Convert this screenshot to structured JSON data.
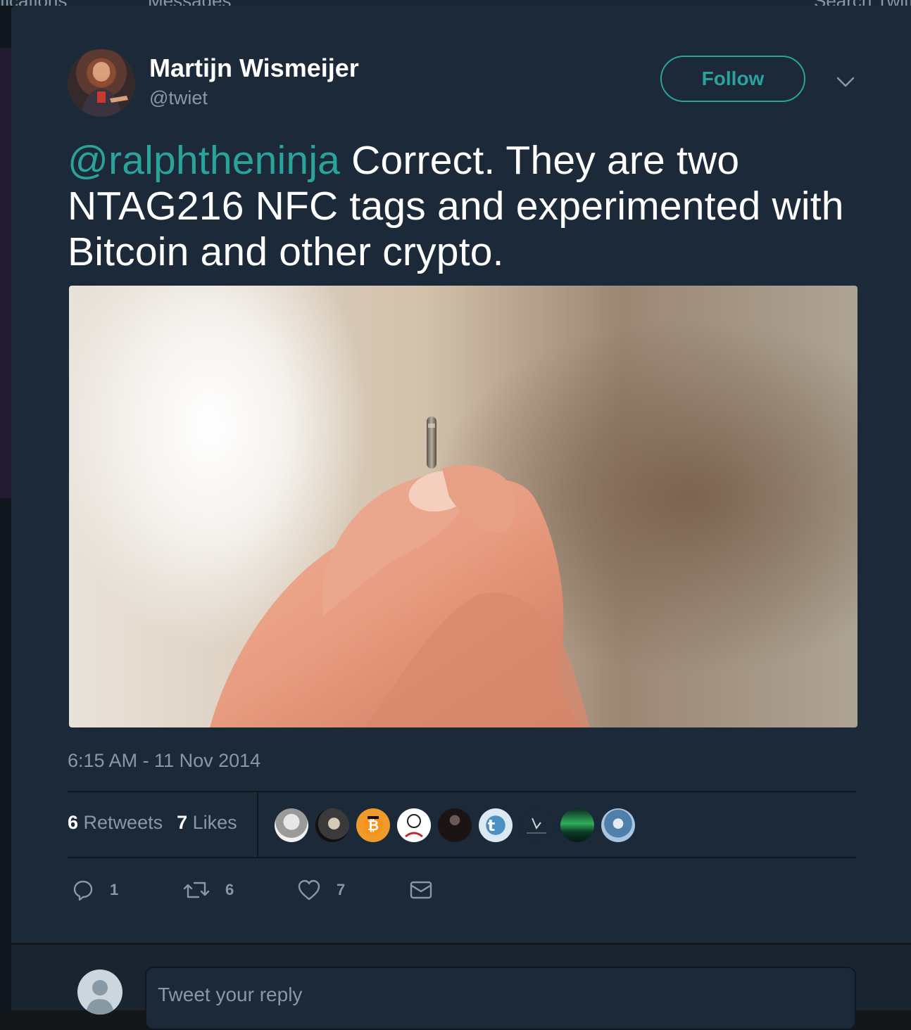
{
  "background": {
    "nav_left_text": "fications",
    "nav_messages_text": "Messages",
    "nav_search_text": "Search Twitter"
  },
  "tweet": {
    "author": {
      "display_name": "Martijn Wismeijer",
      "handle": "@twiet"
    },
    "follow_label": "Follow",
    "mention": "@ralphtheninja",
    "body": " Correct. They are two NTAG216 NFC tags and experimented with Bitcoin and other crypto.",
    "timestamp": "6:15 AM - 11 Nov 2014",
    "retweets_count": "6",
    "retweets_label": "Retweets",
    "likes_count": "7",
    "likes_label": "Likes",
    "likers": [
      "liker-1",
      "liker-2",
      "liker-3",
      "liker-4",
      "liker-5",
      "liker-6",
      "liker-7",
      "liker-8",
      "liker-9"
    ],
    "actions": {
      "reply_count": "1",
      "retweet_count": "6",
      "like_count": "7"
    }
  },
  "reply": {
    "placeholder": "Tweet your reply"
  },
  "colors": {
    "modal_bg": "#1c2938",
    "accent": "#2aa39b",
    "muted": "#8899a6",
    "text": "#ffffff"
  },
  "icons": [
    "chevron-down-icon",
    "reply-icon",
    "retweet-icon",
    "heart-icon",
    "envelope-icon"
  ]
}
